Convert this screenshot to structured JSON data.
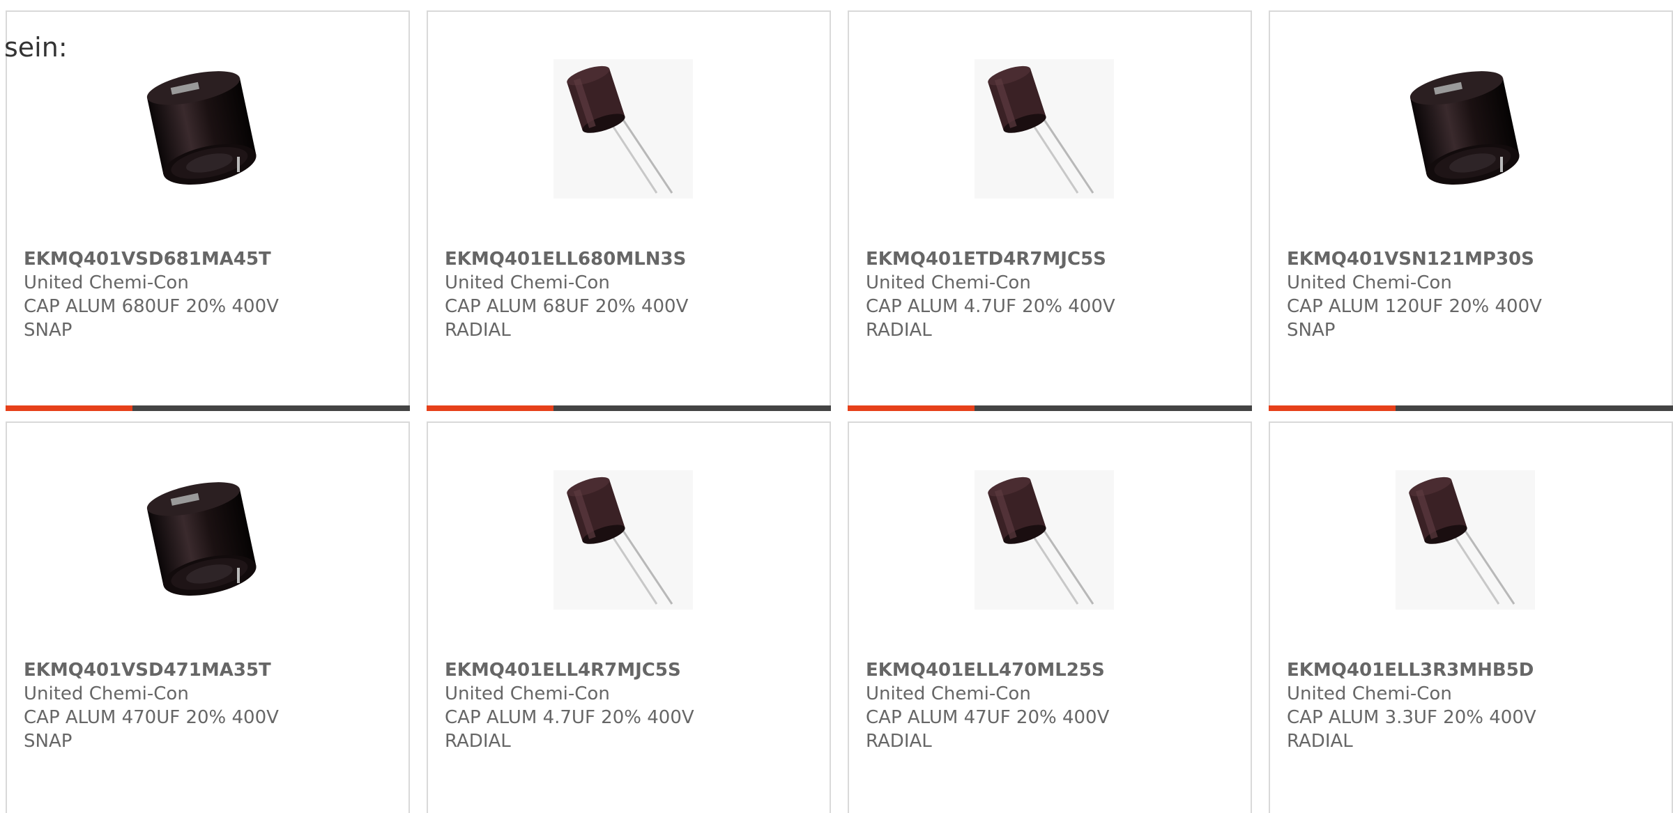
{
  "intro_text": "sein:",
  "colors": {
    "accent": "#e6401a",
    "bar": "#444444",
    "card_border": "#d9d9d9",
    "text": "#666666"
  },
  "products": [
    {
      "part_number": "EKMQ401VSD681MA45T",
      "manufacturer": "United Chemi-Con",
      "description_line1": "CAP ALUM 680UF 20% 400V",
      "description_line2": "SNAP",
      "image": "snap-in-capacitor-image"
    },
    {
      "part_number": "EKMQ401ELL680MLN3S",
      "manufacturer": "United Chemi-Con",
      "description_line1": "CAP ALUM 68UF 20% 400V",
      "description_line2": "RADIAL",
      "image": "radial-capacitor-image"
    },
    {
      "part_number": "EKMQ401ETD4R7MJC5S",
      "manufacturer": "United Chemi-Con",
      "description_line1": "CAP ALUM 4.7UF 20% 400V",
      "description_line2": "RADIAL",
      "image": "radial-capacitor-image"
    },
    {
      "part_number": "EKMQ401VSN121MP30S",
      "manufacturer": "United Chemi-Con",
      "description_line1": "CAP ALUM 120UF 20% 400V",
      "description_line2": "SNAP",
      "image": "snap-in-capacitor-image"
    },
    {
      "part_number": "EKMQ401VSD471MA35T",
      "manufacturer": "United Chemi-Con",
      "description_line1": "CAP ALUM 470UF 20% 400V",
      "description_line2": "SNAP",
      "image": "snap-in-capacitor-image"
    },
    {
      "part_number": "EKMQ401ELL4R7MJC5S",
      "manufacturer": "United Chemi-Con",
      "description_line1": "CAP ALUM 4.7UF 20% 400V",
      "description_line2": "RADIAL",
      "image": "radial-capacitor-image"
    },
    {
      "part_number": "EKMQ401ELL470ML25S",
      "manufacturer": "United Chemi-Con",
      "description_line1": "CAP ALUM 47UF 20% 400V",
      "description_line2": "RADIAL",
      "image": "radial-capacitor-image"
    },
    {
      "part_number": "EKMQ401ELL3R3MHB5D",
      "manufacturer": "United Chemi-Con",
      "description_line1": "CAP ALUM 3.3UF 20% 400V",
      "description_line2": "RADIAL",
      "image": "radial-capacitor-image"
    }
  ]
}
